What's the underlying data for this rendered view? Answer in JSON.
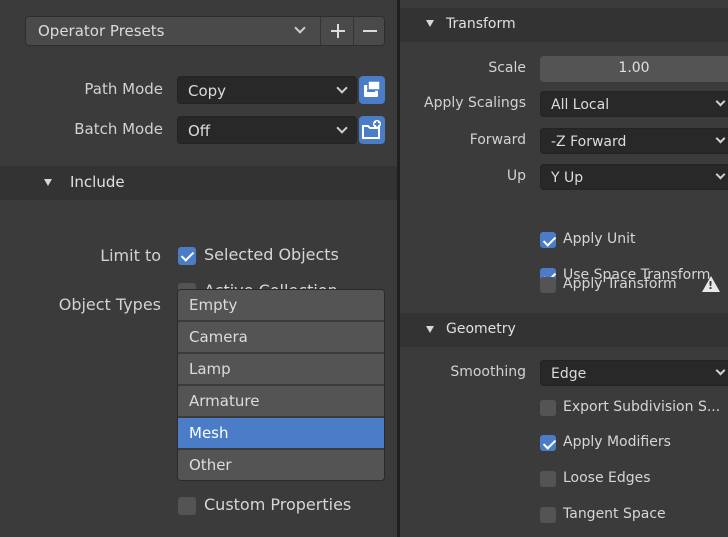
{
  "left": {
    "presets": {
      "label": "Operator Presets",
      "add_icon": "plus-icon",
      "remove_icon": "minus-icon"
    },
    "path_mode": {
      "label": "Path Mode",
      "value": "Copy",
      "icon": "pack-files-icon"
    },
    "batch_mode": {
      "label": "Batch Mode",
      "value": "Off",
      "icon": "new-folder-icon"
    },
    "include": {
      "title": "Include",
      "limit_to": {
        "label": "Limit to",
        "selected_objects": "Selected Objects",
        "active_collection": "Active Collection"
      },
      "object_types": {
        "label": "Object Types",
        "items": [
          "Empty",
          "Camera",
          "Lamp",
          "Armature",
          "Mesh",
          "Other"
        ],
        "selected": "Mesh"
      },
      "custom_properties": "Custom Properties"
    }
  },
  "right": {
    "transform": {
      "title": "Transform",
      "scale": {
        "label": "Scale",
        "value": "1.00"
      },
      "apply_scalings": {
        "label": "Apply Scalings",
        "value": "All Local"
      },
      "forward": {
        "label": "Forward",
        "value": "-Z Forward"
      },
      "up": {
        "label": "Up",
        "value": "Y Up"
      },
      "apply_unit": "Apply Unit",
      "use_space_transform": "Use Space Transform",
      "apply_transform": "Apply Transform",
      "warning_icon": "warning-icon"
    },
    "geometry": {
      "title": "Geometry",
      "smoothing": {
        "label": "Smoothing",
        "value": "Edge"
      },
      "export_subdivision": "Export Subdivision S...",
      "apply_modifiers": "Apply Modifiers",
      "loose_edges": "Loose Edges",
      "tangent_space": "Tangent Space"
    }
  },
  "colors": {
    "accent": "#4a7cc7",
    "panel": "#3b3b3b",
    "field": "#282828",
    "button": "#545454"
  }
}
